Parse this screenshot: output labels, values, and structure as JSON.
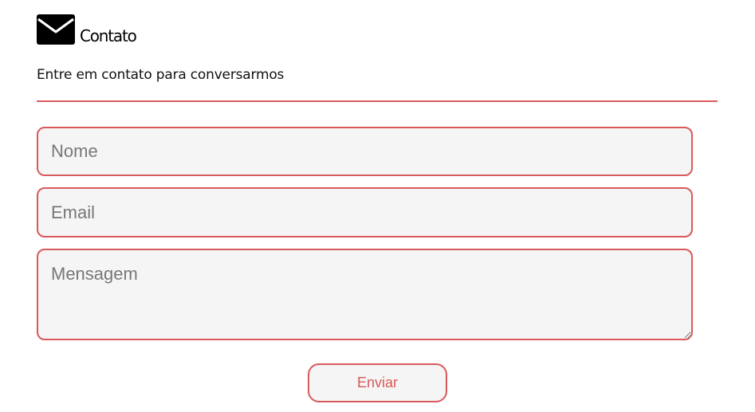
{
  "header": {
    "icon": "mail-icon",
    "title": "Contato",
    "subtitle": "Entre em contato para conversarmos"
  },
  "form": {
    "name_placeholder": "Nome",
    "name_value": "",
    "email_placeholder": "Email",
    "email_value": "",
    "message_placeholder": "Mensagem",
    "message_value": "",
    "submit_label": "Enviar"
  },
  "colors": {
    "accent": "#d9595c",
    "field_background": "#f4f5f4",
    "text": "#000000"
  }
}
